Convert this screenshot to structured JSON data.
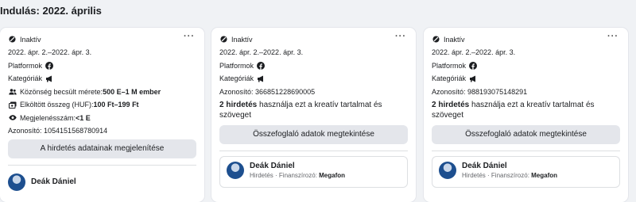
{
  "heading": "Indulás: 2022. április",
  "common": {
    "status": "Inaktív",
    "date_range": "2022. ápr. 2.–2022. ápr. 3.",
    "platforms_label": "Platformok",
    "categories_label": "Kategóriák",
    "more_label": "···"
  },
  "card1": {
    "audience_label": "Közönség becsült mérete: ",
    "audience_value": "500 E–1 M ember",
    "spend_label": "Elköltött összeg (HUF): ",
    "spend_value": "100 Ft–199 Ft",
    "impressions_label": "Megjelenésszám: ",
    "impressions_value": "<1 E",
    "id_text": "Azonosító: 1054151568780914",
    "button": "A hirdetés adatainak megjelenítése",
    "advertiser_name": "Deák Dániel"
  },
  "card2": {
    "id_text": "Azonosító: 366851228690005",
    "uses_bold": "2 hirdetés",
    "uses_rest": " használja ezt a kreatív tartalmat és szöveget",
    "button": "Összefoglaló adatok megtekintése",
    "advertiser_name": "Deák Dániel",
    "advertiser_sub_prefix": "Hirdetés · Finanszírozó: ",
    "advertiser_sponsor": "Megafon"
  },
  "card3": {
    "id_text": "Azonosító: 988193075148291",
    "uses_bold": "2 hirdetés",
    "uses_rest": " használja ezt a kreatív tartalmat és szöveget",
    "button": "Összefoglaló adatok megtekintése",
    "advertiser_name": "Deák Dániel",
    "advertiser_sub_prefix": "Hirdetés · Finanszírozó: ",
    "advertiser_sponsor": "Megafon"
  },
  "icons": {
    "status": "inactive-icon",
    "platform": "facebook-icon",
    "category": "megaphone-icon",
    "audience": "people-icon",
    "spend": "money-icon",
    "impressions": "eye-icon"
  }
}
